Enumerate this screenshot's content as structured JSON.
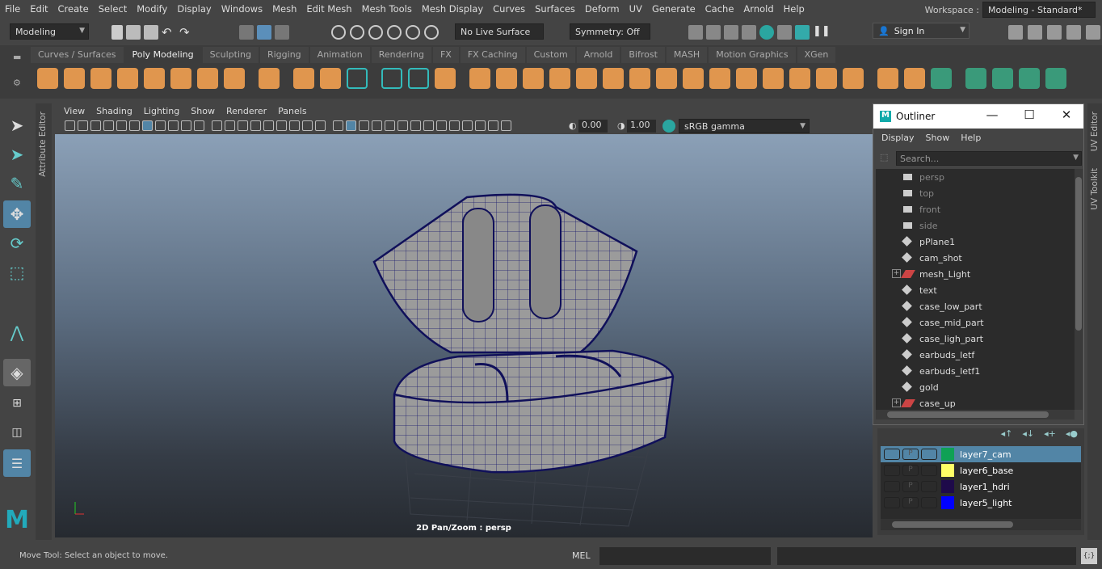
{
  "menu": [
    "File",
    "Edit",
    "Create",
    "Select",
    "Modify",
    "Display",
    "Windows",
    "Mesh",
    "Edit Mesh",
    "Mesh Tools",
    "Mesh Display",
    "Curves",
    "Surfaces",
    "Deform",
    "UV",
    "Generate",
    "Cache",
    "Arnold",
    "Help"
  ],
  "workspace": {
    "label": "Workspace :",
    "value": "Modeling - Standard*"
  },
  "toolbar": {
    "mode": "Modeling",
    "live_surface": "No Live Surface",
    "symmetry": "Symmetry: Off",
    "sign_in": "Sign In"
  },
  "shelf_tabs": [
    "Curves / Surfaces",
    "Poly Modeling",
    "Sculpting",
    "Rigging",
    "Animation",
    "Rendering",
    "FX",
    "FX Caching",
    "Custom",
    "Arnold",
    "Bifrost",
    "MASH",
    "Motion Graphics",
    "XGen"
  ],
  "shelf_active": "Poly Modeling",
  "side_tabs": {
    "left": "Attribute Editor",
    "right1": "UV Editor",
    "right2": "UV Toolkit"
  },
  "viewport": {
    "menu": [
      "View",
      "Shading",
      "Lighting",
      "Show",
      "Renderer",
      "Panels"
    ],
    "exposure": "0.00",
    "gamma": "1.00",
    "color_space": "sRGB gamma",
    "hud": "2D Pan/Zoom : persp"
  },
  "outliner": {
    "title": "Outliner",
    "menu": [
      "Display",
      "Show",
      "Help"
    ],
    "search_placeholder": "Search...",
    "items": [
      {
        "name": "persp",
        "type": "camera"
      },
      {
        "name": "top",
        "type": "camera"
      },
      {
        "name": "front",
        "type": "camera"
      },
      {
        "name": "side",
        "type": "camera"
      },
      {
        "name": "pPlane1",
        "type": "mesh"
      },
      {
        "name": "cam_shot",
        "type": "mesh"
      },
      {
        "name": "mesh_Light",
        "type": "light",
        "expandable": true
      },
      {
        "name": "text",
        "type": "mesh"
      },
      {
        "name": "case_low_part",
        "type": "mesh"
      },
      {
        "name": "case_mid_part",
        "type": "mesh"
      },
      {
        "name": "case_ligh_part",
        "type": "mesh"
      },
      {
        "name": "earbuds_letf",
        "type": "mesh"
      },
      {
        "name": "earbuds_letf1",
        "type": "mesh"
      },
      {
        "name": "gold",
        "type": "mesh"
      },
      {
        "name": "case_up",
        "type": "light",
        "expandable": true
      }
    ]
  },
  "layers": [
    {
      "name": "layer7_cam",
      "color": "#0fa155",
      "selected": true,
      "p": "P"
    },
    {
      "name": "layer6_base",
      "color": "#ffff66",
      "p": "P"
    },
    {
      "name": "layer1_hdri",
      "color": "#1e0a4a",
      "p": "P"
    },
    {
      "name": "layer5_light",
      "color": "#0000ff",
      "p": "P"
    }
  ],
  "status": {
    "help": "Move Tool: Select an object to move.",
    "mel": "MEL",
    "script_icon": "{;}"
  }
}
